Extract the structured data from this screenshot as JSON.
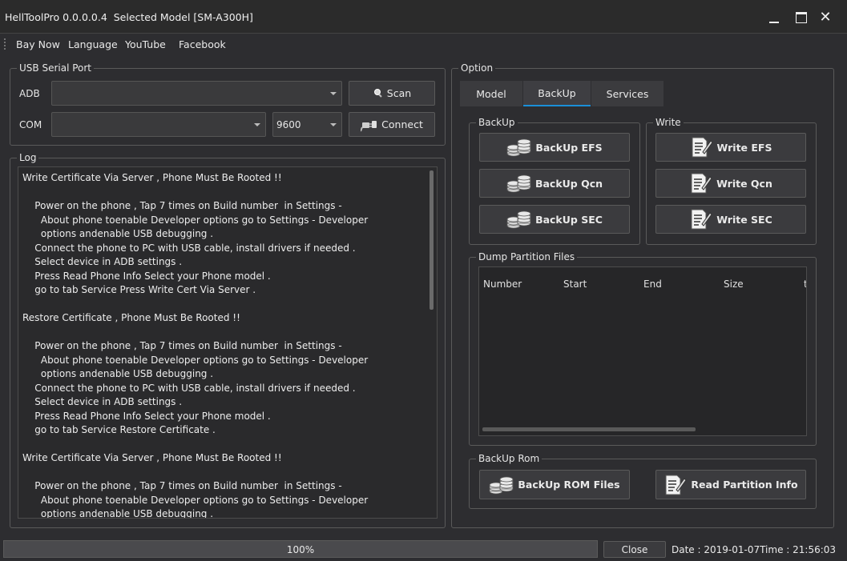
{
  "window": {
    "title": "HellToolPro 0.0.0.0.4  Selected Model [SM-A300H]",
    "close_glyph": "✕"
  },
  "menu": [
    "Bay Now",
    "Language",
    "YouTube",
    "Facebook"
  ],
  "usb": {
    "group_title": "USB Serial Port",
    "adb_label": "ADB",
    "adb_value": "",
    "com_label": "COM",
    "com_value": "",
    "baud_value": "9600",
    "scan_label": "Scan",
    "connect_label": "Connect"
  },
  "log": {
    "group_title": "Log",
    "lines": [
      "Write Certificate Via Server , Phone Must Be Rooted !!",
      "",
      "    Power on the phone , Tap 7 times on Build number  in Settings -",
      "      About phone toenable Developer options go to Settings - Developer",
      "      options andenable USB debugging .",
      "    Connect the phone to PC with USB cable, install drivers if needed .",
      "    Select device in ADB settings .",
      "    Press Read Phone Info Select your Phone model .",
      "    go to tab Service Press Write Cert Via Server .",
      "",
      "Restore Certificate , Phone Must Be Rooted !!",
      "",
      "    Power on the phone , Tap 7 times on Build number  in Settings -",
      "      About phone toenable Developer options go to Settings - Developer",
      "      options andenable USB debugging .",
      "    Connect the phone to PC with USB cable, install drivers if needed .",
      "    Select device in ADB settings .",
      "    Press Read Phone Info Select your Phone model .",
      "    go to tab Service Restore Certificate .",
      "",
      "Write Certificate Via Server , Phone Must Be Rooted !!",
      "",
      "    Power on the phone , Tap 7 times on Build number  in Settings -",
      "      About phone toenable Developer options go to Settings - Developer",
      "      options andenable USB debugging ."
    ]
  },
  "option": {
    "group_title": "Option",
    "tabs": [
      "Model",
      "BackUp",
      "Services"
    ],
    "active_tab": "BackUp",
    "backup_group": "BackUp",
    "write_group": "Write",
    "backup_buttons": [
      "BackUp EFS",
      "BackUp Qcn",
      "BackUp SEC"
    ],
    "write_buttons": [
      "Write EFS",
      "Write Qcn",
      "Write SEC"
    ],
    "dump_group": "Dump Partition Files",
    "columns": [
      "Number",
      "Start",
      "End",
      "Size",
      "t"
    ],
    "rom_group": "BackUp Rom",
    "rom_backup_label": "BackUp ROM Files",
    "read_partition_label": "Read Partition Info"
  },
  "status": {
    "progress_text": "100%",
    "progress_value": 1.0,
    "close_label": "Close",
    "datetime": "Date : 2019-01-07Time : 21:56:03"
  },
  "icons": {
    "scan": "magnifier-icon",
    "connect": "plug-icon",
    "backup": "coin-stack-icon",
    "write": "document-pen-icon"
  },
  "colors": {
    "background": "#2d2d30",
    "active_tab_accent": "#1a8fd8"
  }
}
